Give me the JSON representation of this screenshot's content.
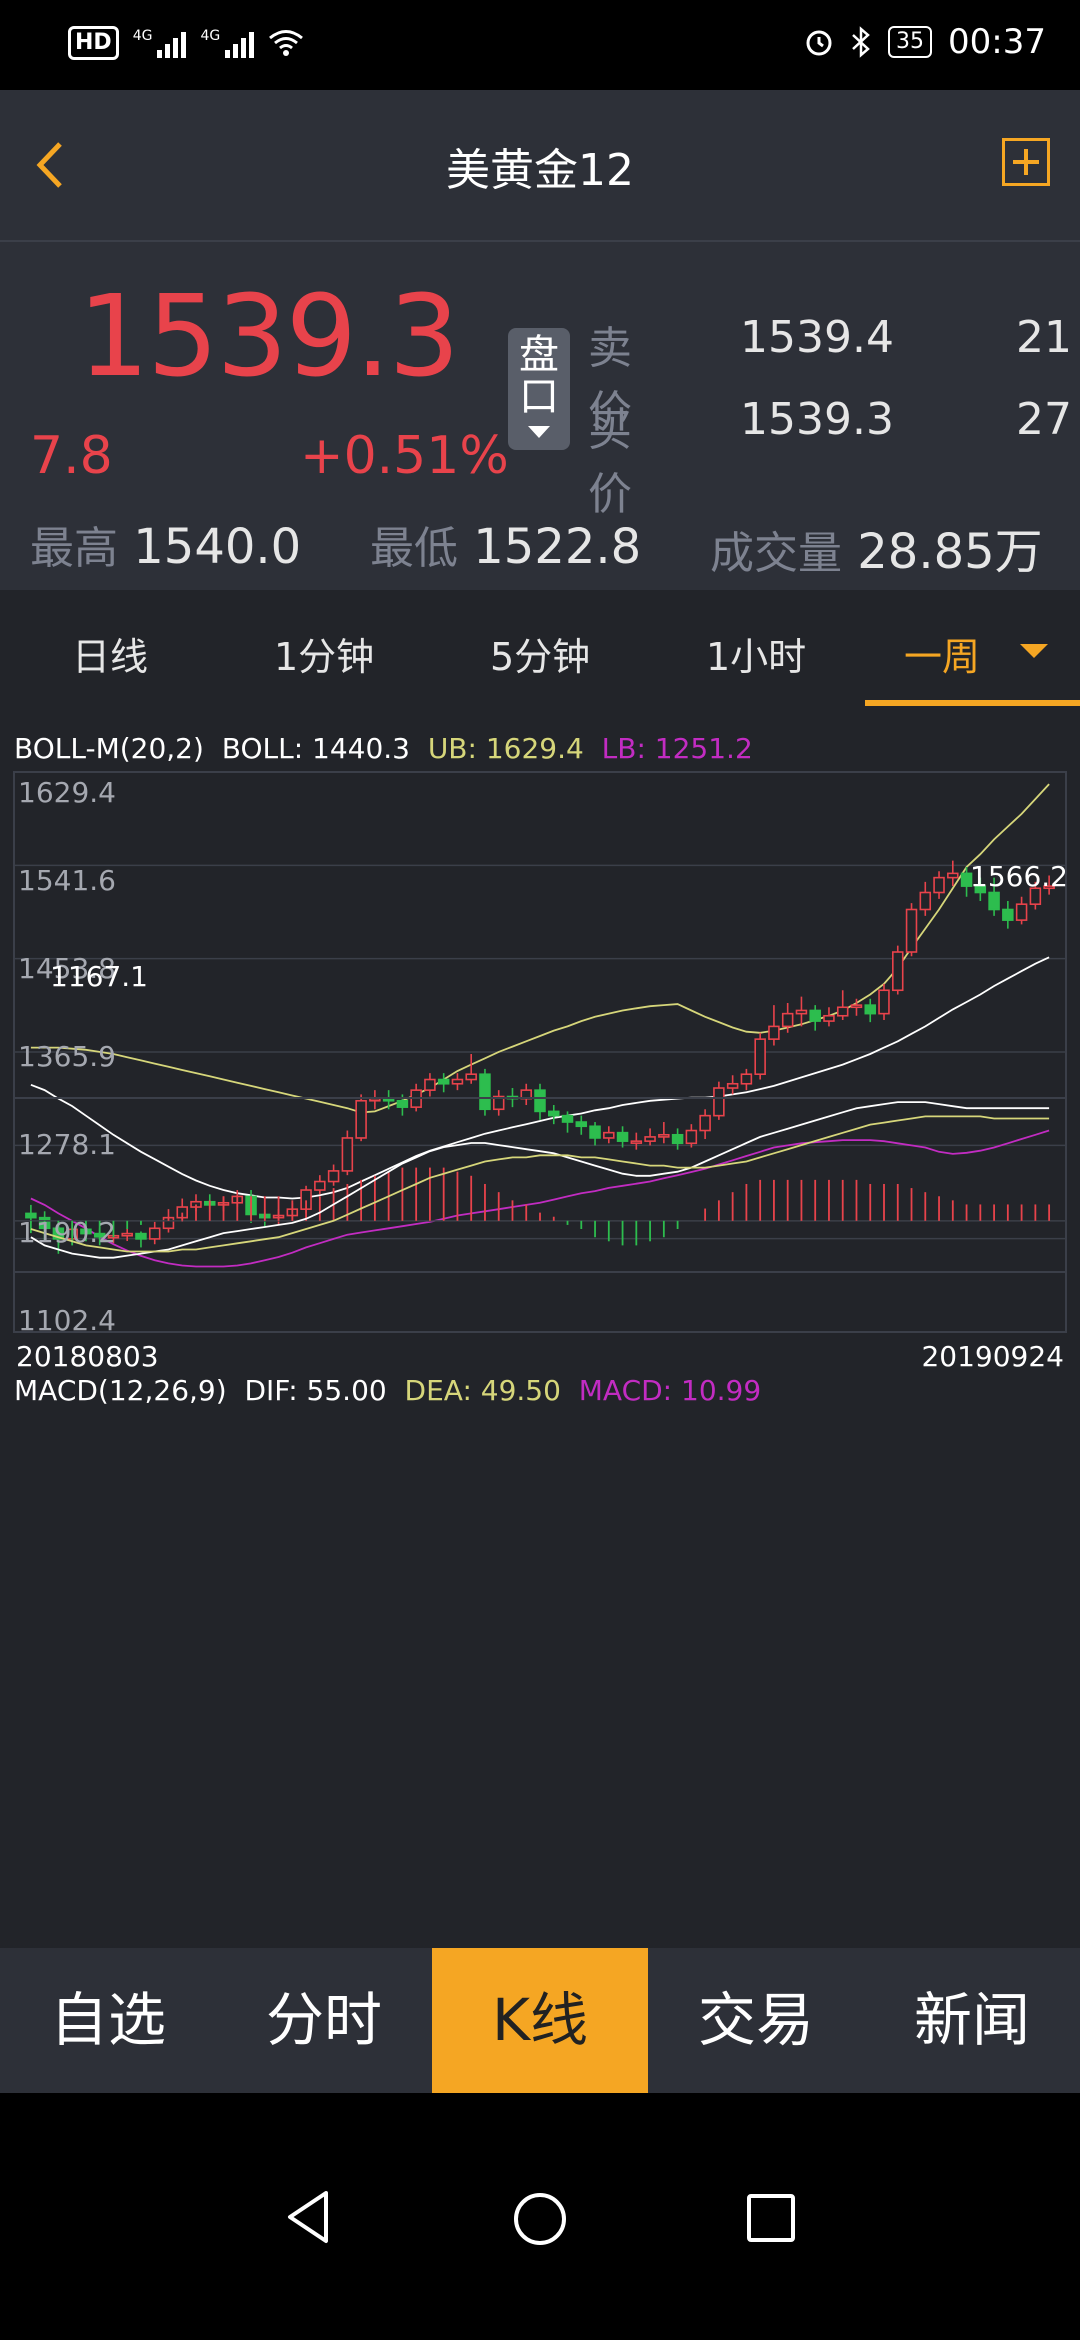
{
  "status_bar": {
    "left_badge": "HD",
    "sig1": "4G",
    "sig2": "4G",
    "battery": "35",
    "time": "00:37"
  },
  "header": {
    "title": "美黄金12"
  },
  "quote": {
    "price": "1539.3",
    "change": "7.8",
    "change_pct": "+0.51%",
    "pankou_label": "盘口",
    "ask_label": "卖价",
    "ask_price": "1539.4",
    "ask_qty": "21",
    "bid_label": "买价",
    "bid_price": "1539.3",
    "bid_qty": "27",
    "high_label": "最高",
    "high": "1540.0",
    "low_label": "最低",
    "low": "1522.8",
    "volume_label": "成交量",
    "volume": "28.85万"
  },
  "periods": [
    "日线",
    "1分钟",
    "5分钟",
    "1小时",
    "一周"
  ],
  "active_period": "一周",
  "legend": {
    "boll_name": "BOLL-M(20,2)",
    "boll": "BOLL: 1440.3",
    "ub": "UB: 1629.4",
    "lb": "LB: 1251.2",
    "macd_name": "MACD(12,26,9)",
    "dif": "DIF: 55.00",
    "dea": "DEA: 49.50",
    "macd": "MACD: 10.99"
  },
  "colors": {
    "up": "#e8434b",
    "down": "#2dbd4e",
    "accent": "#f5a623",
    "ub_line": "#d6d67a",
    "lb_line": "#c22cc2",
    "mid_line": "#ffffff"
  },
  "chart_data": {
    "type": "candlestick",
    "y_ticks": [
      "1629.4",
      "1541.6",
      "1453.8",
      "1365.9",
      "1278.1",
      "1190.2",
      "1102.4"
    ],
    "ylim": [
      1102.4,
      1629.4
    ],
    "x_start": "20180803",
    "x_end": "20190924",
    "max_label": "1566.2",
    "min_label": "1167.1",
    "candles": [
      [
        1214,
        1210,
        1222,
        1205
      ],
      [
        1210,
        1200,
        1216,
        1194
      ],
      [
        1200,
        1190,
        1205,
        1176
      ],
      [
        1190,
        1199,
        1205,
        1186
      ],
      [
        1199,
        1195,
        1206,
        1190
      ],
      [
        1195,
        1192,
        1200,
        1184
      ],
      [
        1192,
        1193,
        1198,
        1186
      ],
      [
        1193,
        1195,
        1200,
        1188
      ],
      [
        1195,
        1190,
        1197,
        1182
      ],
      [
        1190,
        1200,
        1206,
        1185
      ],
      [
        1200,
        1210,
        1218,
        1196
      ],
      [
        1210,
        1220,
        1228,
        1206
      ],
      [
        1220,
        1225,
        1232,
        1216
      ],
      [
        1225,
        1222,
        1232,
        1215
      ],
      [
        1222,
        1224,
        1230,
        1216
      ],
      [
        1224,
        1230,
        1236,
        1220
      ],
      [
        1230,
        1213,
        1236,
        1205
      ],
      [
        1213,
        1210,
        1218,
        1202
      ],
      [
        1210,
        1212,
        1218,
        1204
      ],
      [
        1212,
        1218,
        1224,
        1208
      ],
      [
        1218,
        1236,
        1240,
        1214
      ],
      [
        1236,
        1244,
        1250,
        1232
      ],
      [
        1244,
        1254,
        1260,
        1240
      ],
      [
        1254,
        1285,
        1292,
        1250
      ],
      [
        1285,
        1320,
        1326,
        1282
      ],
      [
        1320,
        1322,
        1330,
        1312
      ],
      [
        1322,
        1320,
        1330,
        1312
      ],
      [
        1320,
        1314,
        1326,
        1306
      ],
      [
        1314,
        1330,
        1336,
        1310
      ],
      [
        1330,
        1340,
        1346,
        1324
      ],
      [
        1340,
        1336,
        1346,
        1328
      ],
      [
        1336,
        1340,
        1346,
        1330
      ],
      [
        1340,
        1345,
        1364,
        1336
      ],
      [
        1345,
        1312,
        1350,
        1306
      ],
      [
        1312,
        1324,
        1330,
        1306
      ],
      [
        1324,
        1322,
        1332,
        1314
      ],
      [
        1322,
        1330,
        1336,
        1316
      ],
      [
        1330,
        1310,
        1336,
        1302
      ],
      [
        1310,
        1306,
        1316,
        1298
      ],
      [
        1306,
        1300,
        1310,
        1290
      ],
      [
        1300,
        1296,
        1306,
        1288
      ],
      [
        1296,
        1285,
        1300,
        1278
      ],
      [
        1285,
        1290,
        1296,
        1280
      ],
      [
        1290,
        1282,
        1296,
        1276
      ],
      [
        1282,
        1282,
        1290,
        1274
      ],
      [
        1282,
        1286,
        1294,
        1278
      ],
      [
        1286,
        1288,
        1300,
        1280
      ],
      [
        1288,
        1280,
        1294,
        1274
      ],
      [
        1280,
        1292,
        1298,
        1276
      ],
      [
        1292,
        1306,
        1312,
        1284
      ],
      [
        1306,
        1332,
        1338,
        1302
      ],
      [
        1332,
        1336,
        1344,
        1326
      ],
      [
        1336,
        1345,
        1350,
        1330
      ],
      [
        1345,
        1378,
        1384,
        1340
      ],
      [
        1378,
        1390,
        1410,
        1372
      ],
      [
        1390,
        1402,
        1412,
        1384
      ],
      [
        1402,
        1405,
        1418,
        1390
      ],
      [
        1405,
        1395,
        1410,
        1386
      ],
      [
        1395,
        1400,
        1408,
        1390
      ],
      [
        1400,
        1408,
        1424,
        1396
      ],
      [
        1408,
        1410,
        1416,
        1400
      ],
      [
        1410,
        1402,
        1416,
        1394
      ],
      [
        1402,
        1424,
        1430,
        1396
      ],
      [
        1424,
        1460,
        1466,
        1420
      ],
      [
        1460,
        1500,
        1506,
        1456
      ],
      [
        1500,
        1516,
        1526,
        1494
      ],
      [
        1516,
        1530,
        1536,
        1510
      ],
      [
        1530,
        1534,
        1546,
        1522
      ],
      [
        1534,
        1522,
        1540,
        1512
      ],
      [
        1522,
        1516,
        1530,
        1508
      ],
      [
        1516,
        1500,
        1530,
        1494
      ],
      [
        1500,
        1490,
        1508,
        1482
      ],
      [
        1490,
        1505,
        1512,
        1486
      ],
      [
        1505,
        1520,
        1526,
        1500
      ],
      [
        1520,
        1522,
        1532,
        1514
      ]
    ],
    "boll_mid": [
      1335,
      1330,
      1322,
      1315,
      1306,
      1297,
      1288,
      1280,
      1272,
      1265,
      1258,
      1251,
      1245,
      1240,
      1236,
      1233,
      1231,
      1229,
      1229,
      1228,
      1229,
      1231,
      1234,
      1238,
      1244,
      1250,
      1256,
      1262,
      1268,
      1273,
      1277,
      1281,
      1285,
      1289,
      1292,
      1295,
      1298,
      1301,
      1304,
      1306,
      1308,
      1311,
      1313,
      1316,
      1318,
      1320,
      1321,
      1322,
      1323,
      1323,
      1324,
      1326,
      1328,
      1331,
      1334,
      1338,
      1342,
      1346,
      1350,
      1354,
      1359,
      1364,
      1370,
      1376,
      1383,
      1390,
      1398,
      1406,
      1413,
      1420,
      1428,
      1435,
      1442,
      1449,
      1455
    ],
    "boll_ub": [
      1370,
      1370,
      1370,
      1369,
      1368,
      1366,
      1364,
      1361,
      1358,
      1355,
      1352,
      1349,
      1346,
      1343,
      1340,
      1337,
      1334,
      1331,
      1328,
      1325,
      1322,
      1319,
      1316,
      1313,
      1309,
      1310,
      1315,
      1320,
      1326,
      1332,
      1340,
      1348,
      1354,
      1360,
      1366,
      1371,
      1376,
      1381,
      1386,
      1390,
      1395,
      1399,
      1402,
      1405,
      1407,
      1409,
      1410,
      1411,
      1405,
      1399,
      1394,
      1389,
      1385,
      1384,
      1386,
      1389,
      1392,
      1396,
      1400,
      1405,
      1412,
      1420,
      1430,
      1445,
      1464,
      1482,
      1500,
      1520,
      1540,
      1552,
      1566,
      1578,
      1590,
      1604,
      1618
    ],
    "boll_lb": [
      1228,
      1222,
      1214,
      1207,
      1200,
      1192,
      1185,
      1179,
      1174,
      1170,
      1167,
      1165,
      1164,
      1164,
      1164,
      1165,
      1167,
      1170,
      1173,
      1177,
      1182,
      1186,
      1190,
      1194,
      1196,
      1198,
      1200,
      1202,
      1204,
      1206,
      1209,
      1212,
      1214,
      1216,
      1218,
      1220,
      1222,
      1224,
      1227,
      1230,
      1233,
      1235,
      1238,
      1240,
      1242,
      1244,
      1247,
      1250,
      1253,
      1256,
      1260,
      1264,
      1268,
      1272,
      1276,
      1278,
      1280,
      1281,
      1282,
      1283,
      1283,
      1283,
      1282,
      1280,
      1278,
      1276,
      1272,
      1270,
      1271,
      1273,
      1276,
      1280,
      1284,
      1288,
      1292
    ],
    "macd_series": {
      "dif": [
        -8,
        -12,
        -14,
        -16,
        -17,
        -18,
        -18,
        -17,
        -16,
        -15,
        -14,
        -12,
        -10,
        -8,
        -6,
        -5,
        -4,
        -3,
        -2,
        -1,
        1,
        4,
        8,
        12,
        16,
        20,
        24,
        28,
        31,
        34,
        36,
        37,
        38,
        38,
        37,
        36,
        35,
        34,
        33,
        31,
        29,
        27,
        25,
        23,
        22,
        22,
        23,
        24,
        26,
        29,
        32,
        35,
        38,
        41,
        43,
        45,
        47,
        49,
        51,
        53,
        55,
        56,
        57,
        58,
        58,
        58,
        57,
        56,
        55,
        55,
        55,
        55,
        55,
        55,
        55
      ],
      "dea": [
        -4,
        -6,
        -8,
        -10,
        -12,
        -13,
        -14,
        -15,
        -15,
        -15,
        -15,
        -14,
        -14,
        -13,
        -12,
        -11,
        -10,
        -9,
        -8,
        -6,
        -4,
        -2,
        0,
        3,
        6,
        9,
        12,
        15,
        18,
        21,
        23,
        25,
        27,
        29,
        30,
        31,
        31,
        32,
        32,
        32,
        31,
        31,
        30,
        29,
        28,
        27,
        27,
        26,
        26,
        26,
        27,
        28,
        29,
        31,
        33,
        35,
        37,
        39,
        41,
        43,
        45,
        47,
        48,
        49,
        50,
        51,
        51,
        51,
        51,
        51,
        50,
        50,
        50,
        50,
        50
      ],
      "macd": [
        -6,
        -10,
        -12,
        -12,
        -10,
        -9,
        -8,
        -4,
        -2,
        0,
        2,
        4,
        8,
        10,
        12,
        12,
        12,
        12,
        12,
        10,
        10,
        12,
        16,
        18,
        20,
        22,
        24,
        26,
        26,
        26,
        26,
        24,
        22,
        18,
        14,
        10,
        8,
        4,
        2,
        -2,
        -4,
        -8,
        -10,
        -12,
        -12,
        -10,
        -8,
        -4,
        0,
        6,
        10,
        14,
        18,
        20,
        20,
        20,
        20,
        20,
        20,
        20,
        20,
        18,
        18,
        18,
        16,
        14,
        12,
        10,
        8,
        8,
        8,
        8,
        8,
        8,
        8
      ]
    }
  },
  "tabs": [
    "自选",
    "分时",
    "K线",
    "交易",
    "新闻"
  ],
  "active_tab": "K线"
}
